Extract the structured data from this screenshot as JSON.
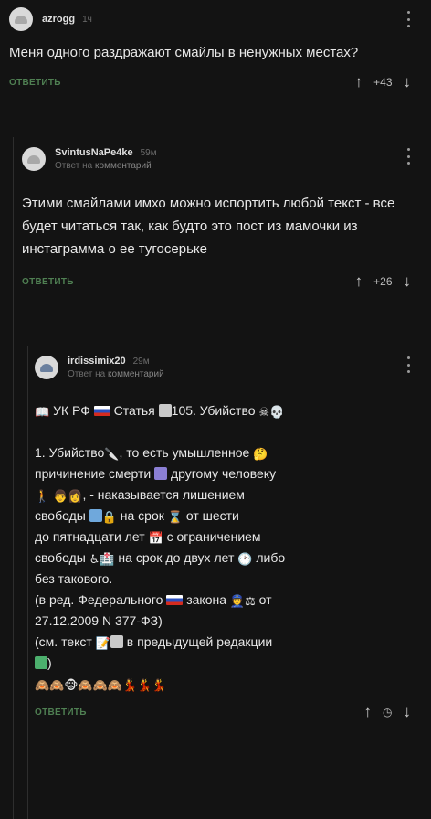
{
  "comments": [
    {
      "user": "azrogg",
      "time": "1ч",
      "reply_to_prefix": "",
      "reply_to_target": "",
      "text": "Меня одного раздражают смайлы в ненужных местах?",
      "reply_label": "ОТВЕТИТЬ",
      "score": "+43"
    },
    {
      "user": "SvintusNaPe4ke",
      "time": "59м",
      "reply_to_prefix": "Ответ на",
      "reply_to_target": "комментарий",
      "text": "Этими смайлами имхо можно испортить любой текст - все будет читаться так, как будто это пост из мамочки из инстаграмма о ее тугосерьке",
      "reply_label": "ОТВЕТИТЬ",
      "score": "+26"
    },
    {
      "user": "irdissimix20",
      "time": "29м",
      "reply_to_prefix": "Ответ на",
      "reply_to_target": "комментарий",
      "lines": {
        "title_a": "УК РФ",
        "title_b": "Статья",
        "title_c": "105. Убийство",
        "p1": "1. Убийство",
        "p2": ", то есть умышленное",
        "p3": "причинение смерти",
        "p4": "другому человеку",
        "p5": ", - наказывается лишением",
        "p6": "свободы",
        "p7": "на срок",
        "p8": "от шести",
        "p9": "до пятнадцати лет",
        "p10": "с ограничением",
        "p11": "свободы",
        "p12": "на срок до двух лет",
        "p13": "либо",
        "p14": "без такового.",
        "p15": "(в ред. Федерального",
        "p16": "закона",
        "p17": "от",
        "p18": "27.12.2009 N 377-ФЗ)",
        "p19": "(см. текст",
        "p20": "в предыдущей редакции",
        "p21": ")"
      },
      "reply_label": "ОТВЕТИТЬ",
      "score": ""
    }
  ],
  "icons": {
    "upvote": "↑",
    "downvote": "↓",
    "reply_count_icon": "◷"
  }
}
